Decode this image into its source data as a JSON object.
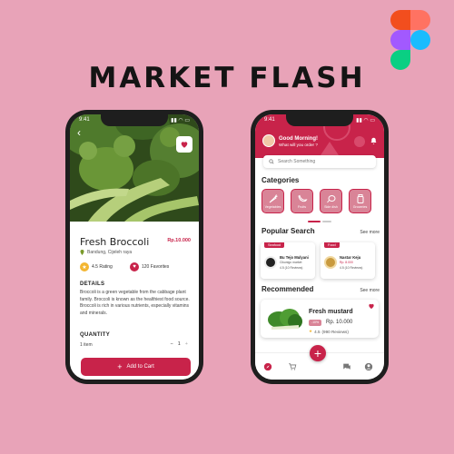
{
  "headline": "MARKET FLASH",
  "colors": {
    "background": "#e8a3b8",
    "accent": "#c8234a",
    "accent_light": "#d98497"
  },
  "detail_screen": {
    "status_time": "9:41",
    "product": {
      "name": "Fresh Broccoli",
      "price": "Rp.10.000",
      "location": "Bandung, Cijeleh raya",
      "rating": "4.5 Rating",
      "favorites": "120 Favorites"
    },
    "details_title": "DETAILS",
    "description": "Broccoli is a green vegetable from the cabbage plant family. Broccoli is known as the healthiest food source. Broccoli is rich in various nutrients, especially vitamins and minerals.",
    "quantity_title": "QUANTITY",
    "quantity_label": "1 item",
    "quantity_value": "1",
    "add_to_cart": "Add to Cart"
  },
  "home_screen": {
    "status_time": "9:41",
    "greeting": "Good Morning!",
    "subgreeting": "What will you order ?",
    "search_placeholder": "Search Something",
    "categories_title": "Categories",
    "categories": [
      {
        "label": "Vegetables",
        "icon": "carrot-icon"
      },
      {
        "label": "Fruits",
        "icon": "banana-icon"
      },
      {
        "label": "Side dish",
        "icon": "meat-icon"
      },
      {
        "label": "Groceries",
        "icon": "jar-icon"
      }
    ],
    "popular_title": "Popular Search",
    "popular_more": "See more",
    "popular": [
      {
        "tag": "Seafood",
        "title": "Bu Tejo Mulyani",
        "store": "Cikunigo market",
        "rating": "4.5 (10 Reviews)"
      },
      {
        "tag": "Food",
        "title": "Nastar Keju",
        "price": "Rp. 8.000",
        "rating": "4.5 (10 Reviews)"
      }
    ],
    "recommended_title": "Recommended",
    "recommended_more": "See more",
    "recommended": {
      "name": "Fresh mustard",
      "badge": "-10%",
      "price": "Rp. 10.000",
      "rating": "4.5",
      "reviews": "(990 Reviews)"
    }
  }
}
